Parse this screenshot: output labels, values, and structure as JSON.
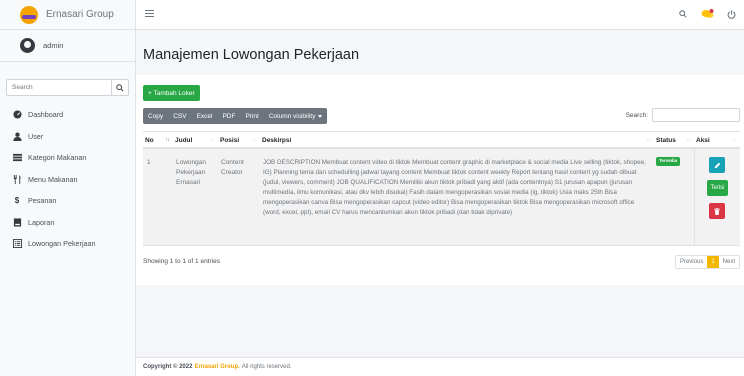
{
  "brand": {
    "name": "Ernasari Group"
  },
  "user": {
    "name": "admin"
  },
  "sidebar": {
    "search_placeholder": "Search",
    "items": [
      {
        "label": "Dashboard",
        "icon": "tachometer-icon"
      },
      {
        "label": "User",
        "icon": "user-icon"
      },
      {
        "label": "Kategori Makanan",
        "icon": "list-icon"
      },
      {
        "label": "Menu Makanan",
        "icon": "utensils-icon"
      },
      {
        "label": "Pesanan",
        "icon": "dollar-icon"
      },
      {
        "label": "Laporan",
        "icon": "book-icon"
      },
      {
        "label": "Lowongan Pekerjaan",
        "icon": "list-alt-icon"
      }
    ]
  },
  "topbar": {
    "icons": [
      "search-icon",
      "comments-icon",
      "power-icon"
    ]
  },
  "page": {
    "title": "Manajemen Lowongan Pekerjaan"
  },
  "toolbar": {
    "add_label": "+ Tambah Loker",
    "export_buttons": [
      "Copy",
      "CSV",
      "Excel",
      "PDF",
      "Print",
      "Column visibility"
    ],
    "search_label": "Search:"
  },
  "table": {
    "columns": [
      "No",
      "Judul",
      "Posisi",
      "Deskirpsi",
      "Status",
      "Aksi"
    ],
    "rows": [
      {
        "no": "1",
        "judul": "Lowongan Pekerjaan Ernasari",
        "posisi": "Content Creator",
        "deskripsi": "JOB DESCRIPTION Membuat content video di tiktok Membuat content graphic di marketplace & social media Live selling (tiktok, shopee, IG) Planning tema dan schedulling jadwal tayang content Membuat tiktok content weekly Report tentang hasil content yg sudah dibuat (judul, viewers, comment) JOB QUALIFICATION Memiliki akun tiktok pribadi yang aktif (ada contentnya) S1 jurusan apapun (jurusan multimedia, ilmu komunikasi, atau dkv lebih disukai) Fasih dalam mengoperasikan sosial media (ig, tiktok) Usia maks 25th Bisa mengoperasikan canva Bisa mengoperasikan capcut (video editor) Bisa mengoperasikan tiktok Bisa mengoperasikan microsoft office (word, excel, ppt), email CV harus mencantumkan akun tiktok pribadi (dan tidak diprivate)",
        "status": "Tersedia",
        "aksi_terisi": "Terisi"
      }
    ]
  },
  "pagination": {
    "info": "Showing 1 to 1 of 1 entries",
    "previous": "Previous",
    "current": "1",
    "next": "Next"
  },
  "footer": {
    "prefix": "Copyright © 2022",
    "brand": "Ernasari Group.",
    "suffix": "All rights reserved."
  },
  "colors": {
    "accent": "#f5a300",
    "success": "#28a745",
    "info": "#17a2b8",
    "danger": "#dc3545",
    "secondary": "#6c757d"
  }
}
